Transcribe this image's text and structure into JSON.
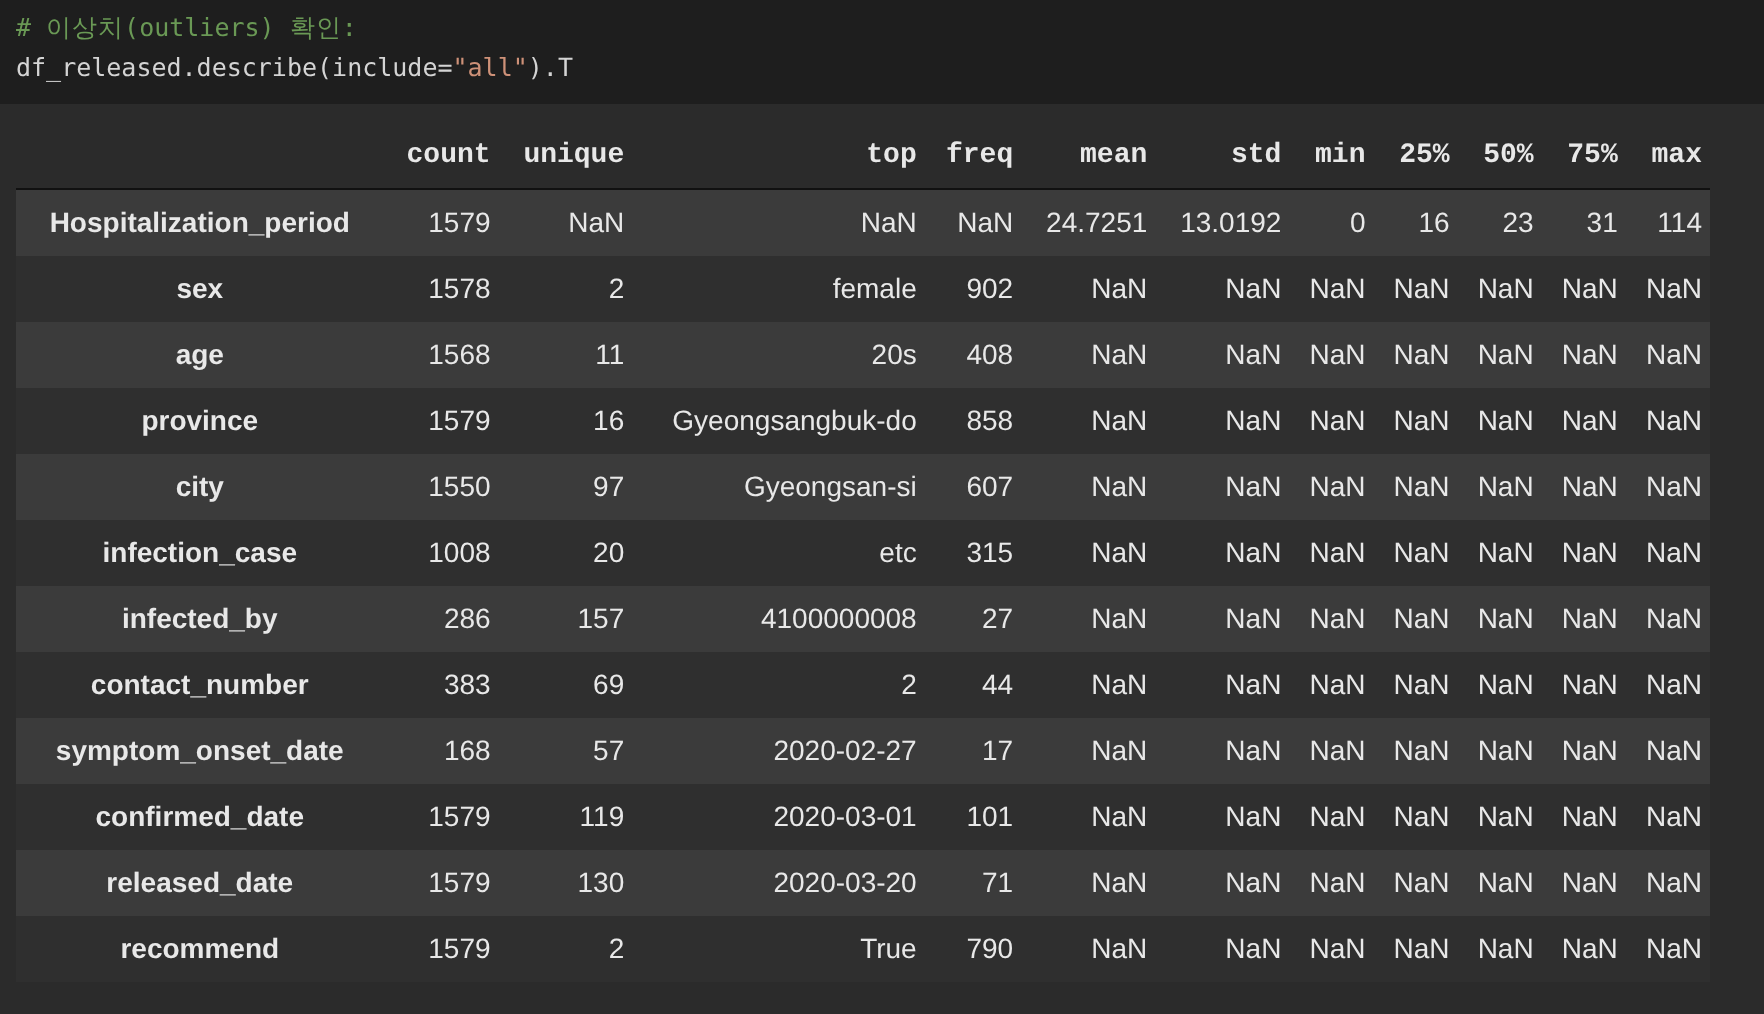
{
  "cell": {
    "comment": "# 이상치(outliers) 확인:",
    "code": [
      {
        "kind": "plain",
        "text": "df_released.describe(include="
      },
      {
        "kind": "string",
        "text": "\"all\""
      },
      {
        "kind": "plain",
        "text": ").T"
      }
    ]
  },
  "table": {
    "columns": [
      "count",
      "unique",
      "top",
      "freq",
      "mean",
      "std",
      "min",
      "25%",
      "50%",
      "75%",
      "max"
    ],
    "rows": [
      {
        "index": "Hospitalization_period",
        "cells": [
          "1579",
          "NaN",
          "NaN",
          "NaN",
          "24.7251",
          "13.0192",
          "0",
          "16",
          "23",
          "31",
          "114"
        ]
      },
      {
        "index": "sex",
        "cells": [
          "1578",
          "2",
          "female",
          "902",
          "NaN",
          "NaN",
          "NaN",
          "NaN",
          "NaN",
          "NaN",
          "NaN"
        ]
      },
      {
        "index": "age",
        "cells": [
          "1568",
          "11",
          "20s",
          "408",
          "NaN",
          "NaN",
          "NaN",
          "NaN",
          "NaN",
          "NaN",
          "NaN"
        ]
      },
      {
        "index": "province",
        "cells": [
          "1579",
          "16",
          "Gyeongsangbuk-do",
          "858",
          "NaN",
          "NaN",
          "NaN",
          "NaN",
          "NaN",
          "NaN",
          "NaN"
        ]
      },
      {
        "index": "city",
        "cells": [
          "1550",
          "97",
          "Gyeongsan-si",
          "607",
          "NaN",
          "NaN",
          "NaN",
          "NaN",
          "NaN",
          "NaN",
          "NaN"
        ]
      },
      {
        "index": "infection_case",
        "cells": [
          "1008",
          "20",
          "etc",
          "315",
          "NaN",
          "NaN",
          "NaN",
          "NaN",
          "NaN",
          "NaN",
          "NaN"
        ]
      },
      {
        "index": "infected_by",
        "cells": [
          "286",
          "157",
          "4100000008",
          "27",
          "NaN",
          "NaN",
          "NaN",
          "NaN",
          "NaN",
          "NaN",
          "NaN"
        ]
      },
      {
        "index": "contact_number",
        "cells": [
          "383",
          "69",
          "2",
          "44",
          "NaN",
          "NaN",
          "NaN",
          "NaN",
          "NaN",
          "NaN",
          "NaN"
        ]
      },
      {
        "index": "symptom_onset_date",
        "cells": [
          "168",
          "57",
          "2020-02-27",
          "17",
          "NaN",
          "NaN",
          "NaN",
          "NaN",
          "NaN",
          "NaN",
          "NaN"
        ]
      },
      {
        "index": "confirmed_date",
        "cells": [
          "1579",
          "119",
          "2020-03-01",
          "101",
          "NaN",
          "NaN",
          "NaN",
          "NaN",
          "NaN",
          "NaN",
          "NaN"
        ]
      },
      {
        "index": "released_date",
        "cells": [
          "1579",
          "130",
          "2020-03-20",
          "71",
          "NaN",
          "NaN",
          "NaN",
          "NaN",
          "NaN",
          "NaN",
          "NaN"
        ]
      },
      {
        "index": "recommend",
        "cells": [
          "1579",
          "2",
          "True",
          "790",
          "NaN",
          "NaN",
          "NaN",
          "NaN",
          "NaN",
          "NaN",
          "NaN"
        ]
      }
    ]
  }
}
